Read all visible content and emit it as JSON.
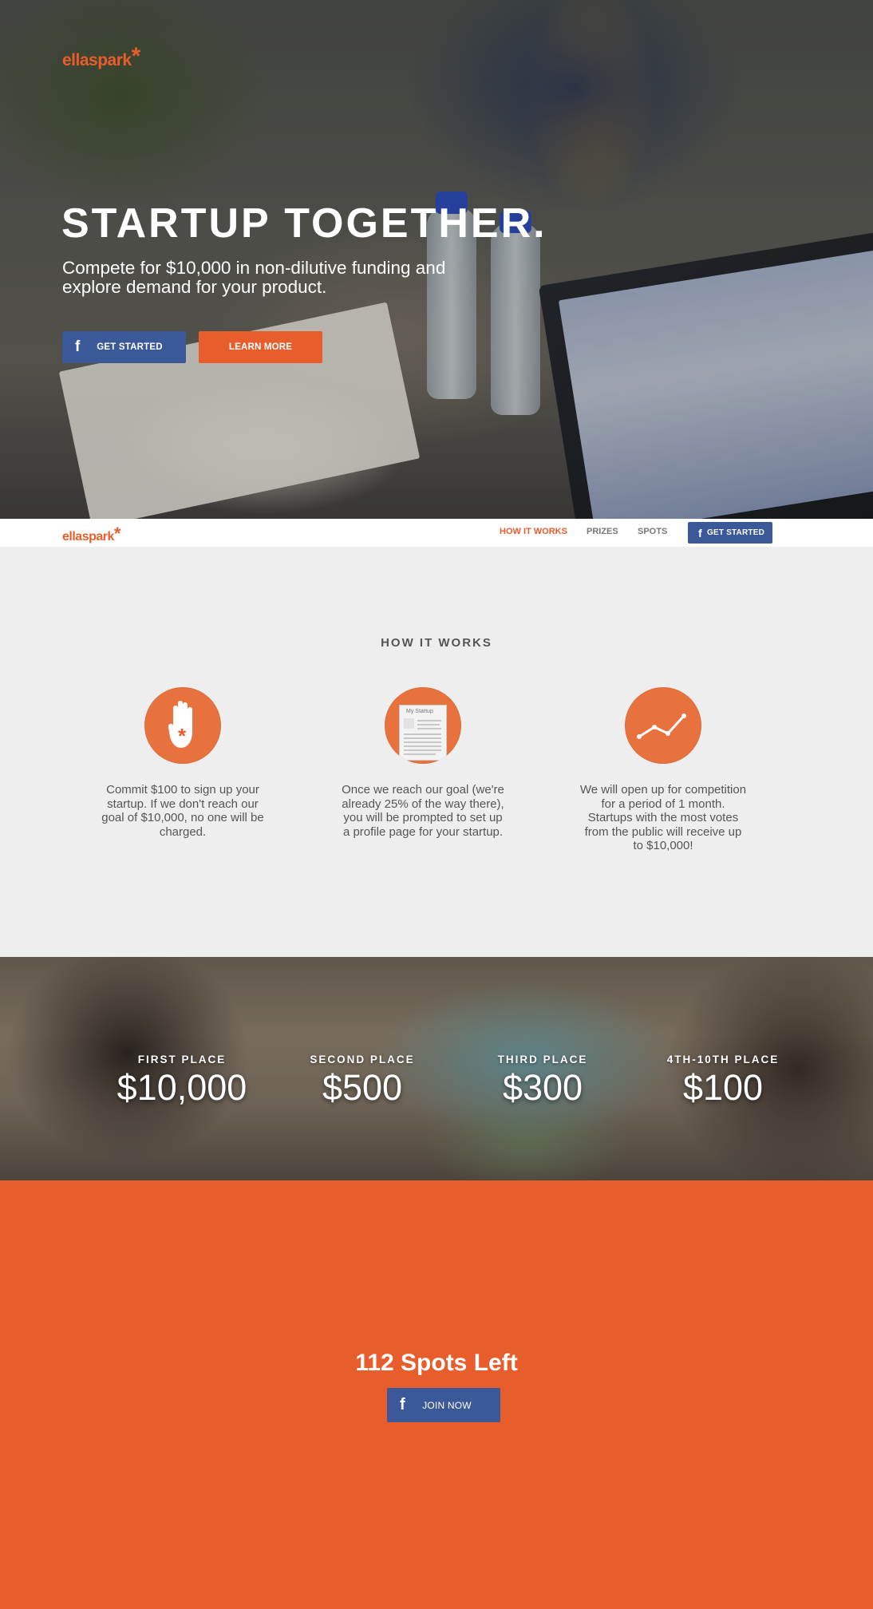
{
  "brand": {
    "name": "ellaspark",
    "star": "*",
    "accent": "#e85d2c",
    "facebook_blue": "#3b5899"
  },
  "hero": {
    "title": "STARTUP TOGETHER.",
    "subtitle": "Compete for $10,000 in non-dilutive funding and explore demand for your product.",
    "primary_button": {
      "label": "GET STARTED",
      "icon": "facebook-icon"
    },
    "secondary_button": {
      "label": "LEARN MORE"
    }
  },
  "navbar": {
    "links": [
      {
        "label": "HOW IT WORKS",
        "active": true
      },
      {
        "label": "PRIZES",
        "active": false
      },
      {
        "label": "SPOTS",
        "active": false
      }
    ],
    "button": {
      "label": "GET STARTED",
      "icon": "facebook-icon"
    }
  },
  "how_it_works": {
    "title": "HOW IT WORKS",
    "steps": [
      {
        "icon": "raised-hand-icon",
        "text": "Commit $100 to sign up your startup. If we don't reach our goal of $10,000, no one will be charged."
      },
      {
        "icon": "profile-page-icon",
        "icon_caption": "My Startup",
        "text": "Once we reach our goal (we're already 25% of the way there), you will be prompted to set up a profile page for your startup."
      },
      {
        "icon": "trend-line-icon",
        "text": "We will open up for competition for a period of 1 month. Startups with the most votes from the public will receive up to $10,000!"
      }
    ]
  },
  "prizes": [
    {
      "label": "FIRST PLACE",
      "amount": "$10,000"
    },
    {
      "label": "SECOND PLACE",
      "amount": "$500"
    },
    {
      "label": "THIRD PLACE",
      "amount": "$300"
    },
    {
      "label": "4TH-10TH PLACE",
      "amount": "$100"
    }
  ],
  "spots": {
    "title": "112 Spots Left",
    "button": {
      "label": "JOIN NOW",
      "icon": "facebook-icon"
    }
  }
}
